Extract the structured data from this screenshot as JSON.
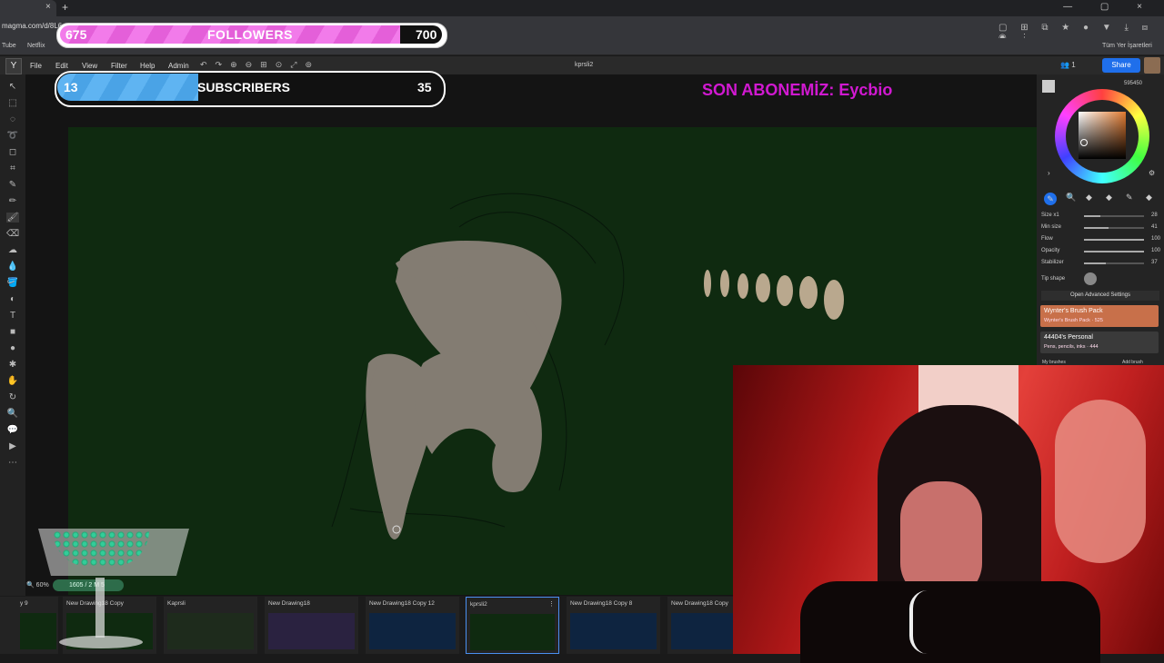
{
  "browser": {
    "url": "magma.com/d/8L6",
    "bookmarks": [
      "Tube",
      "Netflix"
    ],
    "bookmarks_right": "Tüm Yer İşaretleri",
    "new_tab": "+",
    "tab_close": "×",
    "window_controls": "— ▢ ×"
  },
  "app": {
    "logo": "Y",
    "menu": [
      "File",
      "Edit",
      "View",
      "Filter",
      "Help",
      "Admin"
    ],
    "doc_title": "kprsli2",
    "users_count": "1",
    "share_label": "Share"
  },
  "overlays": {
    "followers": {
      "current": "675",
      "label": "FOLLOWERS",
      "goal": "700",
      "fill_fraction": 0.98
    },
    "subscribers": {
      "current": "13",
      "label": "SUBSCRIBERS",
      "goal": "35",
      "fill_fraction": 0.37
    },
    "last_sub": "SON ABONEMİZ: Eycbio"
  },
  "right_panel": {
    "color_number": "595450",
    "accent_color": "#e07a30",
    "sliders": [
      {
        "label": "Size x1",
        "value": "28",
        "fraction": 0.28
      },
      {
        "label": "Min size",
        "value": "41",
        "fraction": 0.41
      },
      {
        "label": "Flow",
        "value": "100",
        "fraction": 1.0
      },
      {
        "label": "Opacity",
        "value": "100",
        "fraction": 1.0
      },
      {
        "label": "Stabilizer",
        "value": "37",
        "fraction": 0.37
      }
    ],
    "tip_shape_label": "Tip shape",
    "advanced_label": "Open Advanced Settings",
    "packs": [
      {
        "title": "Wynter's Brush Pack",
        "sub": "Wynter's Brush Pack · 525"
      },
      {
        "title": "44404's Personal",
        "sub": "Pens, pencils, inks · 444"
      }
    ],
    "my_brushes": "My brushes",
    "add_brush": "Add brush"
  },
  "bottom": {
    "zoom": "60%",
    "layer_info": "1605 / 2",
    "layer_extra": "M 5",
    "thumbnails": [
      "y 9",
      "New Drawing18 Copy",
      "Kaprsli",
      "New Drawing18",
      "New Drawing18 Copy 12",
      "kprsli2",
      "New Drawing18 Copy 8",
      "New Drawing18 Copy"
    ]
  }
}
